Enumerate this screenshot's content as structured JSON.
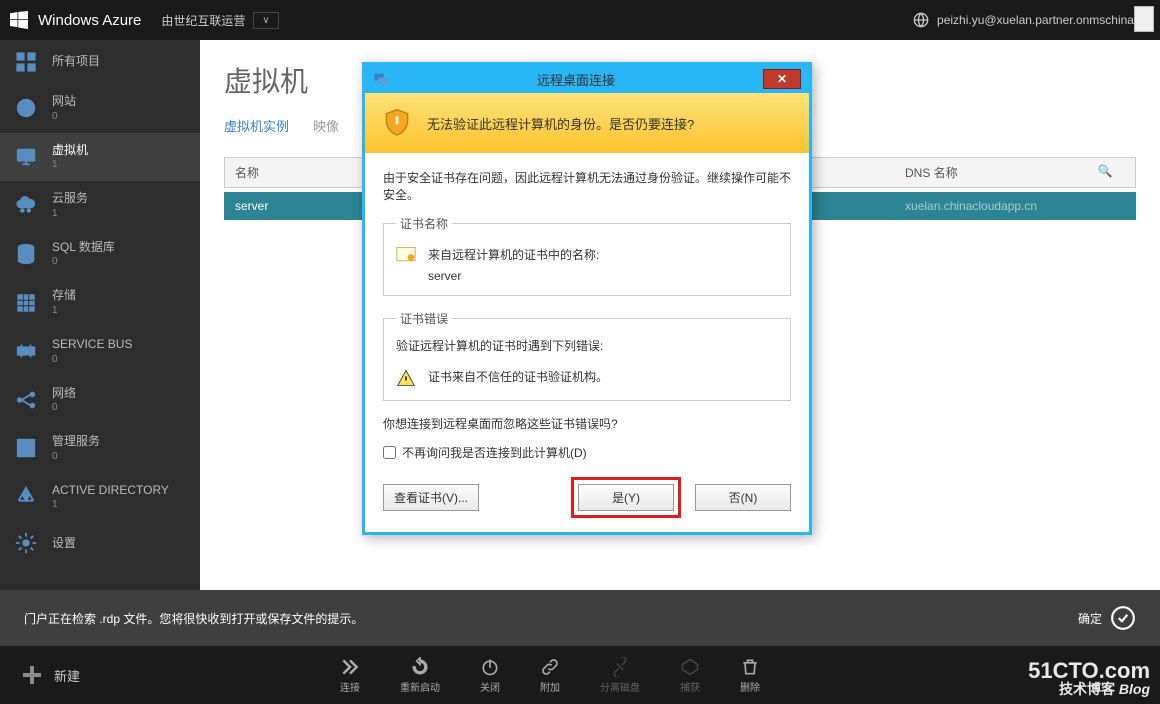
{
  "topbar": {
    "brand": "Windows Azure",
    "provider": "由世纪互联运营",
    "user": "peizhi.yu@xuelan.partner.onmschina.cn"
  },
  "sidebar": {
    "items": [
      {
        "label": "所有项目",
        "count": ""
      },
      {
        "label": "网站",
        "count": "0"
      },
      {
        "label": "虚拟机",
        "count": "1"
      },
      {
        "label": "云服务",
        "count": "1"
      },
      {
        "label": "SQL 数据库",
        "count": "0"
      },
      {
        "label": "存储",
        "count": "1"
      },
      {
        "label": "SERVICE BUS",
        "count": "0"
      },
      {
        "label": "网络",
        "count": "0"
      },
      {
        "label": "管理服务",
        "count": "0"
      },
      {
        "label": "ACTIVE DIRECTORY",
        "count": "1"
      },
      {
        "label": "设置",
        "count": ""
      }
    ]
  },
  "main": {
    "title": "虚拟机",
    "tabs": [
      "虚拟机实例",
      "映像"
    ],
    "th_name": "名称",
    "th_dns": "DNS 名称",
    "row": {
      "name": "server",
      "dns": "xuelan.chinacloudapp.cn"
    }
  },
  "notice": {
    "text": "门户正在检索 .rdp 文件。您将很快收到打开或保存文件的提示。",
    "ok": "确定"
  },
  "bb": {
    "new": "新建",
    "a": [
      "连接",
      "重新启动",
      "关闭",
      "附加",
      "分离磁盘",
      "捕获",
      "删除"
    ]
  },
  "dlg": {
    "title": "远程桌面连接",
    "warn": "无法验证此远程计算机的身份。是否仍要连接?",
    "sub": "由于安全证书存在问题，因此远程计算机无法通过身份验证。继续操作可能不安全。",
    "cert_legend": "证书名称",
    "cert_label": "来自远程计算机的证书中的名称:",
    "cert_value": "server",
    "err_legend": "证书错误",
    "err_label": "验证远程计算机的证书时遇到下列错误:",
    "err_value": "证书来自不信任的证书验证机构。",
    "q": "你想连接到远程桌面而忽略这些证书错误吗?",
    "chk": "不再询问我是否连接到此计算机(D)",
    "view": "查看证书(V)...",
    "yes": "是(Y)",
    "no": "否(N)"
  },
  "wm": {
    "l1": "51CTO.com",
    "l2": "技术博客",
    "l3": "Blog"
  }
}
